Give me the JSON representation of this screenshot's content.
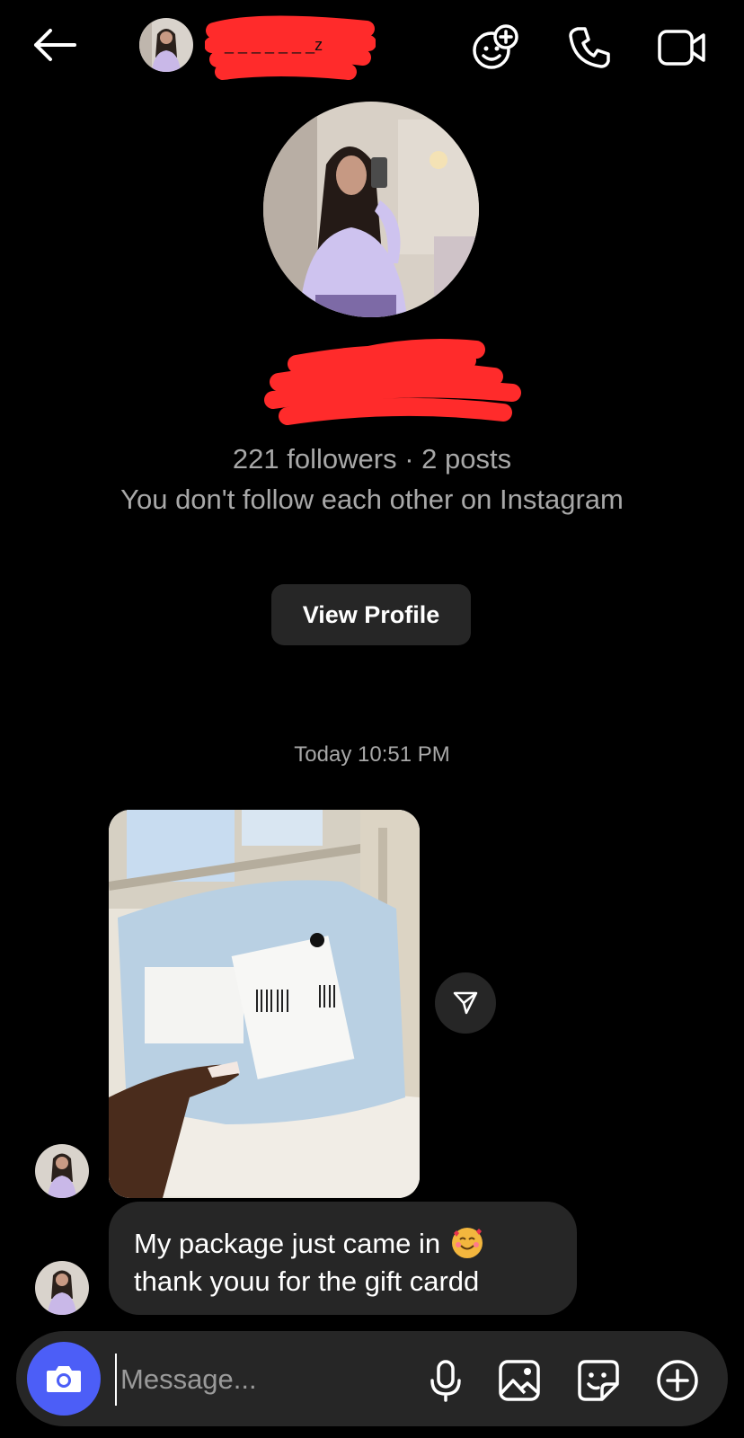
{
  "header": {
    "username": "_ _ _ _ _ _ _z",
    "icons": [
      "back-arrow-icon",
      "effects-icon",
      "phone-icon",
      "video-camera-icon"
    ]
  },
  "profile": {
    "stats": "221 followers · 2 posts",
    "context": "You don't follow each other on Instagram",
    "view_profile_label": "View Profile"
  },
  "thread": {
    "timestamp": "Today 10:51 PM",
    "messages": [
      {
        "type": "photo",
        "caption": ""
      },
      {
        "type": "text",
        "line1": "My package just came in",
        "line2": "thank youu for the gift cardd",
        "emoji": "smiling-face-with-hearts"
      }
    ]
  },
  "composer": {
    "placeholder": "Message...",
    "icons": [
      "camera-icon",
      "microphone-icon",
      "gallery-icon",
      "sticker-icon",
      "plus-icon"
    ]
  },
  "colors": {
    "background": "#000000",
    "surface": "#262626",
    "secondary_text": "#a8a8a8",
    "camera_button": "#4c5ef7",
    "redaction": "#ff2b2b"
  }
}
